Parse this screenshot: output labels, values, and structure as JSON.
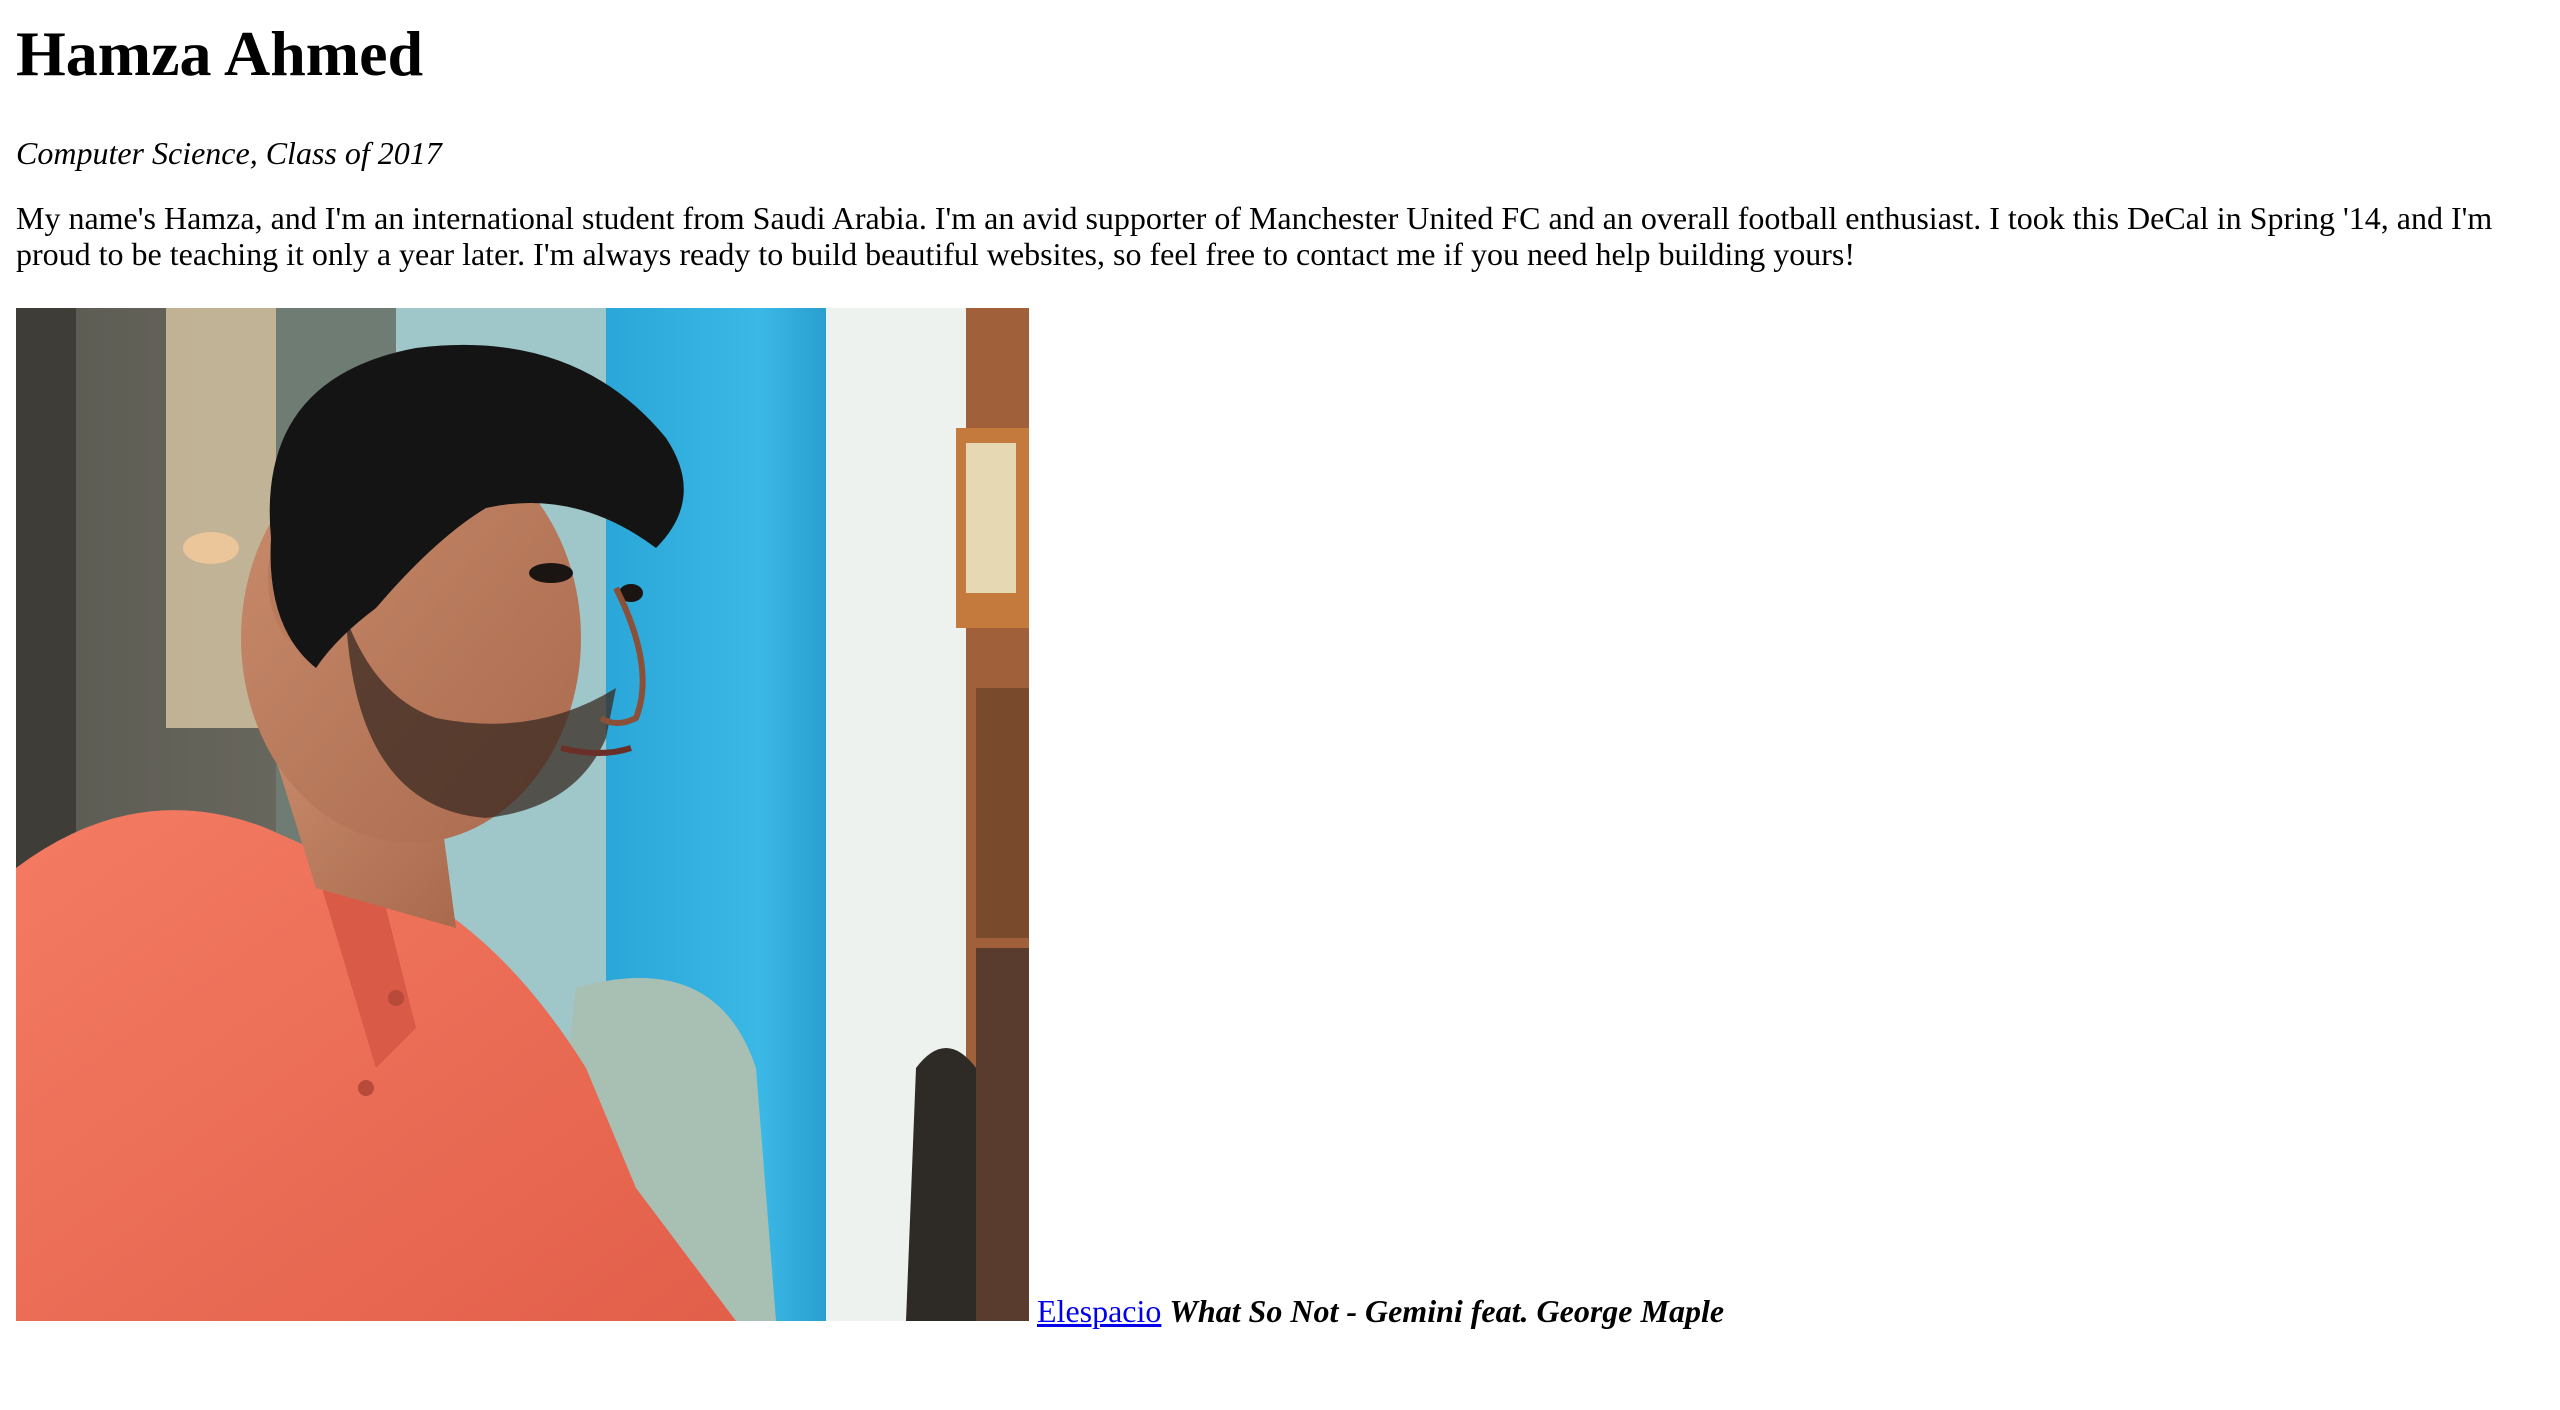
{
  "profile": {
    "name": "Hamza Ahmed",
    "subtitle": "Computer Science, Class of 2017",
    "bio": "My name's Hamza, and I'm an international student from Saudi Arabia. I'm an avid supporter of Manchester United FC and an overall football enthusiast. I took this DeCal in Spring '14, and I'm proud to be teaching it only a year later. I'm always ready to build beautiful websites, so feel free to contact me if you need help building yours!"
  },
  "music": {
    "link_label": "Elespacio",
    "track": "What So Not - Gemini feat. George Maple"
  },
  "colors": {
    "link": "#0000ee",
    "text": "#000000",
    "background": "#ffffff",
    "shirt": "#f2705a",
    "wall_blue": "#2fb0e0"
  }
}
